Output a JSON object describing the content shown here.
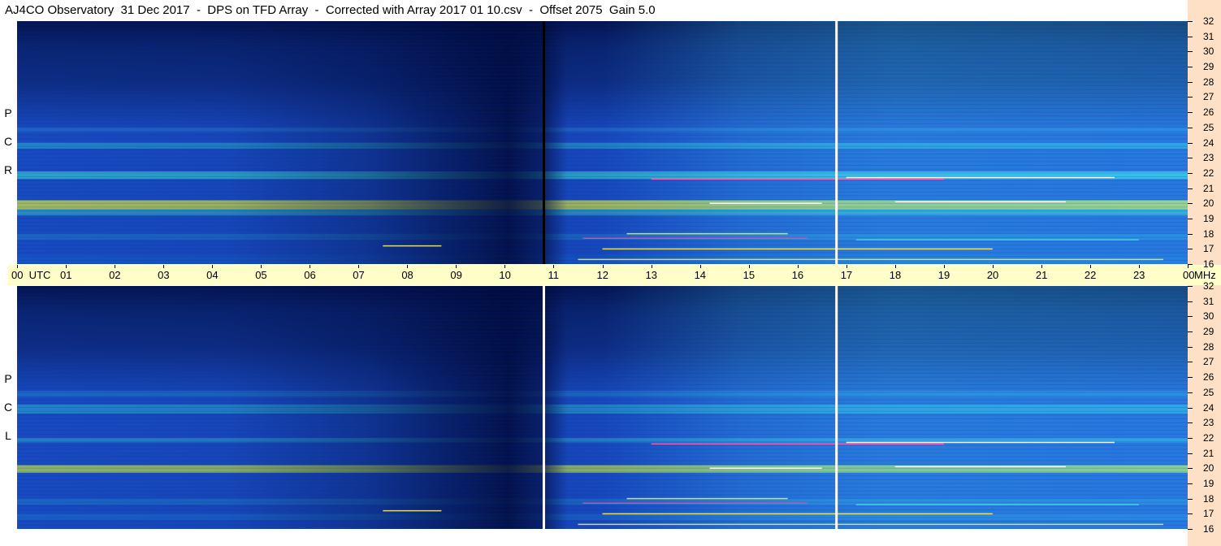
{
  "title": "AJ4CO Observatory  31 Dec 2017  -  DPS on TFD Array  -  Corrected with Array 2017 01 10.csv  -  Offset 2075  Gain 5.0",
  "polarization": {
    "top": [
      "R",
      "C",
      "P"
    ],
    "bottom": [
      "L",
      "C",
      "P"
    ]
  },
  "chart_data": {
    "type": "heatmap",
    "x_ticks": [
      "00",
      "01",
      "02",
      "03",
      "04",
      "05",
      "06",
      "07",
      "08",
      "09",
      "10",
      "11",
      "12",
      "13",
      "14",
      "15",
      "16",
      "17",
      "18",
      "19",
      "20",
      "21",
      "22",
      "23",
      "00"
    ],
    "x_unit": "UTC",
    "x_range_hours": [
      0,
      24
    ],
    "y_ticks": [
      "32",
      "31",
      "30",
      "29",
      "28",
      "27",
      "26",
      "25",
      "24",
      "23",
      "22",
      "21",
      "20",
      "19",
      "18",
      "17",
      "16"
    ],
    "y_unit": "MHz",
    "y_range_mhz": [
      16,
      32
    ],
    "panels": [
      "RCP",
      "LCP"
    ],
    "gap_markers_hours": [
      10.8,
      16.8
    ],
    "colors": {
      "low": "#000a3c",
      "mid": "#1a5fe0",
      "high": "#40e0d0",
      "peak": "#f0f040",
      "burst": "#ff40a0"
    }
  }
}
